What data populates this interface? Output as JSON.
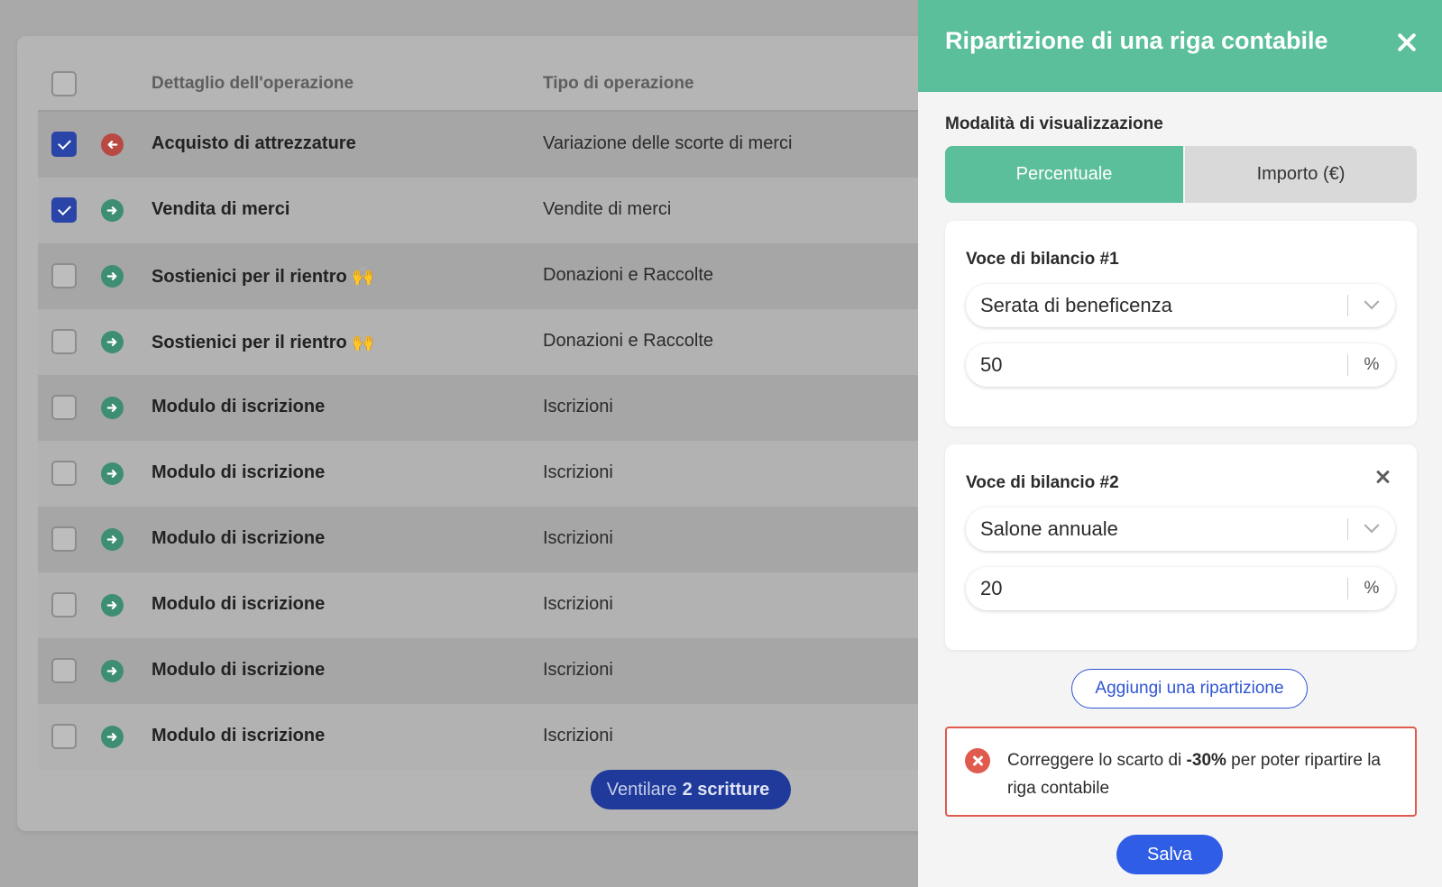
{
  "table": {
    "headers": [
      "Dettaglio dell'operazione",
      "Tipo di operazione"
    ],
    "rows": [
      {
        "checked": true,
        "direction": "out",
        "detail": "Acquisto di attrezzature",
        "type": "Variazione delle scorte di merci"
      },
      {
        "checked": true,
        "direction": "in",
        "detail": "Vendita di merci",
        "type": "Vendite di merci"
      },
      {
        "checked": false,
        "direction": "in",
        "detail": "Sostienici per il rientro 🙌",
        "type": "Donazioni e Raccolte"
      },
      {
        "checked": false,
        "direction": "in",
        "detail": "Sostienici per il rientro 🙌",
        "type": "Donazioni e Raccolte"
      },
      {
        "checked": false,
        "direction": "in",
        "detail": "Modulo di iscrizione",
        "type": "Iscrizioni"
      },
      {
        "checked": false,
        "direction": "in",
        "detail": "Modulo di iscrizione",
        "type": "Iscrizioni"
      },
      {
        "checked": false,
        "direction": "in",
        "detail": "Modulo di iscrizione",
        "type": "Iscrizioni"
      },
      {
        "checked": false,
        "direction": "in",
        "detail": "Modulo di iscrizione",
        "type": "Iscrizioni"
      },
      {
        "checked": false,
        "direction": "in",
        "detail": "Modulo di iscrizione",
        "type": "Iscrizioni"
      },
      {
        "checked": false,
        "direction": "in",
        "detail": "Modulo di iscrizione",
        "type": "Iscrizioni"
      }
    ],
    "ventilate_button": {
      "prefix": "Ventilare",
      "count": "2 scritture"
    }
  },
  "panel": {
    "title": "Ripartizione di una riga contabile",
    "mode_label": "Modalità di visualizzazione",
    "tabs": [
      {
        "label": "Percentuale",
        "active": true
      },
      {
        "label": "Importo (€)",
        "active": false
      }
    ],
    "entries": [
      {
        "title": "Voce di bilancio #1",
        "item": "Serata di beneficenza",
        "value": "50",
        "unit": "%"
      },
      {
        "title": "Voce di bilancio #2",
        "item": "Salone annuale",
        "value": "20",
        "unit": "%"
      }
    ],
    "add_button": "Aggiungi una ripartizione",
    "alert": {
      "before": "Correggere lo scarto di ",
      "bold": "-30%",
      "after": " per poter ripartire la riga contabile"
    },
    "save_button": "Salva"
  },
  "colors": {
    "accent_green": "#5bbf9b",
    "primary_blue": "#2f5de6",
    "error_red": "#e05a4e"
  }
}
